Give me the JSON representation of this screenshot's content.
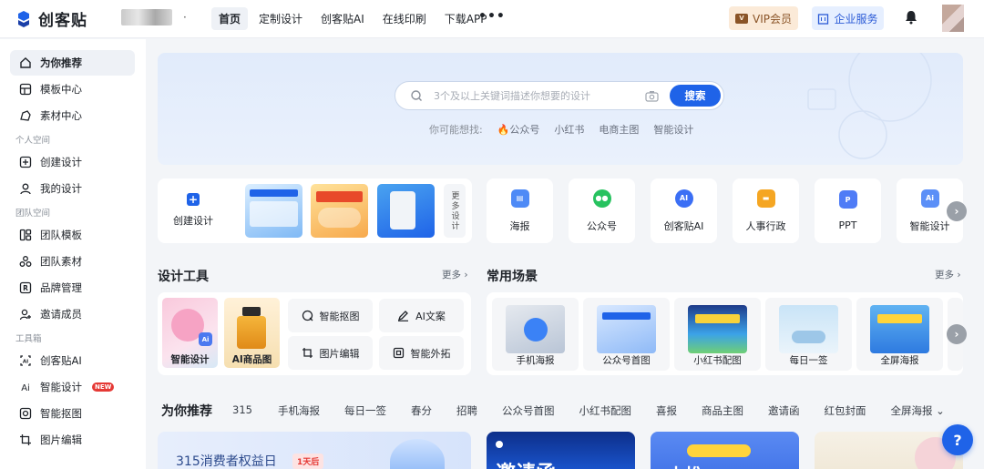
{
  "brand": {
    "name": "创客贴"
  },
  "header": {
    "nav": [
      "首页",
      "定制设计",
      "创客贴AI",
      "在线印刷",
      "下载APP"
    ],
    "vip_label": "VIP会员",
    "enterprise_label": "企业服务"
  },
  "sidebar": {
    "top": [
      {
        "label": "为你推荐",
        "icon": "home-icon"
      },
      {
        "label": "模板中心",
        "icon": "template-icon"
      },
      {
        "label": "素材中心",
        "icon": "material-icon"
      }
    ],
    "personal_heading": "个人空间",
    "personal": [
      {
        "label": "创建设计",
        "icon": "create-icon"
      },
      {
        "label": "我的设计",
        "icon": "user-icon"
      }
    ],
    "team_heading": "团队空间",
    "team": [
      {
        "label": "团队模板",
        "icon": "grid-icon"
      },
      {
        "label": "团队素材",
        "icon": "cluster-icon"
      },
      {
        "label": "品牌管理",
        "icon": "brand-icon"
      },
      {
        "label": "邀请成员",
        "icon": "invite-icon"
      }
    ],
    "tools_heading": "工具箱",
    "tools": [
      {
        "label": "创客贴AI",
        "icon": "ai-icon"
      },
      {
        "label": "智能设计",
        "icon": "ai-design-icon",
        "badge": "NEW"
      },
      {
        "label": "智能抠图",
        "icon": "cutout-icon"
      },
      {
        "label": "图片编辑",
        "icon": "crop-icon"
      }
    ]
  },
  "search": {
    "placeholder": "3个及以上关键词描述你想要的设计",
    "button": "搜索",
    "suggest_label": "你可能想找:",
    "suggestions": [
      "公众号",
      "小红书",
      "电商主图",
      "智能设计"
    ]
  },
  "create": {
    "label": "创建设计",
    "more": "更多设计"
  },
  "categories": [
    {
      "label": "海报",
      "color": "#3b82f6",
      "icon": "poster-icon"
    },
    {
      "label": "公众号",
      "color": "#22c55e",
      "icon": "wechat-icon"
    },
    {
      "label": "创客贴AI",
      "color": "#3b6ff5",
      "icon": "ai-icon"
    },
    {
      "label": "人事行政",
      "color": "#f59e0b",
      "icon": "hr-icon"
    },
    {
      "label": "PPT",
      "color": "#4f7cf6",
      "icon": "ppt-icon"
    },
    {
      "label": "智能设计",
      "color": "#3b82f6",
      "icon": "ai-design-icon"
    }
  ],
  "design_tools": {
    "title": "设计工具",
    "more": "更多",
    "images": [
      "智能设计",
      "AI商品图"
    ],
    "buttons": [
      "智能抠图",
      "AI文案",
      "图片编辑",
      "智能外拓"
    ]
  },
  "scenes": {
    "title": "常用场景",
    "more": "更多",
    "items": [
      "手机海报",
      "公众号首图",
      "小红书配图",
      "每日一签",
      "全屏海报"
    ]
  },
  "recommend": {
    "title": "为你推荐",
    "tabs": [
      "315",
      "手机海报",
      "每日一签",
      "春分",
      "招聘",
      "公众号首图",
      "小红书配图",
      "喜报",
      "商品主图",
      "邀请函",
      "红包封面",
      "全屏海报"
    ],
    "banner_text": "315消费者权益日",
    "banner_badge": "1天后",
    "card2_text": "邀请函",
    "card3_text": "内推"
  },
  "help": "?"
}
